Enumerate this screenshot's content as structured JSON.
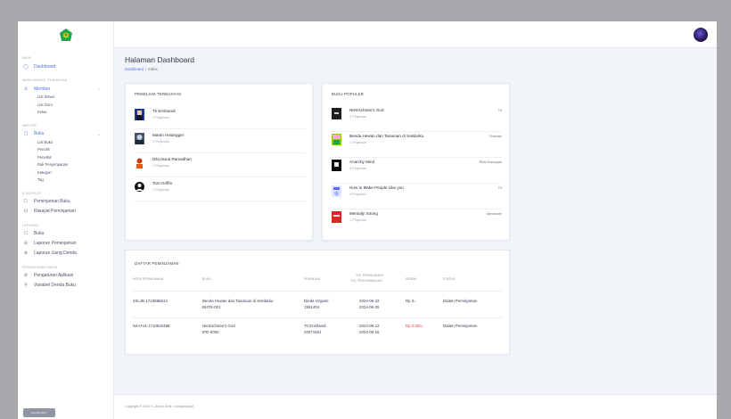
{
  "sidebar": {
    "section_main": "MAIN",
    "dashboard": "Dashboard",
    "section_user": "MANAGEMENT PENGGUNA",
    "member": "Member",
    "member_items": [
      "List Siswa",
      "List Guru",
      "Kelas"
    ],
    "section_master": "MASTER",
    "buku": "Buku",
    "buku_items": [
      "List Buku",
      "Penulis",
      "Penerbit",
      "Rak Penyimpanan",
      "Kategori",
      "Tag"
    ],
    "section_eservice": "E-SERVICE",
    "peminjaman": "Peminjaman Buku",
    "riwayat": "Riwayat Peminjaman",
    "section_laporan": "LAPORAN",
    "lap_buku": "Buku",
    "lap_peminjaman": "Laporan Peminjaman",
    "lap_denda": "Laporan Uang Denda",
    "section_pengaturan": "PENGATURAN UMUM",
    "pengaturan_aplikasi": "Pengaturan Aplikasi",
    "variabel_denda": "Variabel Denda Buku",
    "bottom_button": "SHARE EDIT"
  },
  "header": {
    "title": "Halaman Dashboard",
    "breadcrumb_link": "Dashboard",
    "breadcrumb_sep": "/",
    "breadcrumb_current": "Index"
  },
  "peminjam": {
    "title": "PEMINJAM TERBANYAK",
    "items": [
      {
        "name": "Tri Enshandi",
        "count": "2 Pinjaman"
      },
      {
        "name": "Martin Heidegger",
        "count": "1 Pinjaman"
      },
      {
        "name": "Dila Nurul Ramadhan",
        "count": "1 Pinjaman"
      },
      {
        "name": "Tom Griffin",
        "count": "1 Pinjaman"
      }
    ]
  },
  "populer": {
    "title": "BUKU POPULER",
    "items": [
      {
        "name": "Nietzschean's God",
        "count": "1 Pinjaman",
        "author": "Tri"
      },
      {
        "name": "Benda Hewan dan Tanaman di Sekitarku",
        "count": "1 Pinjaman",
        "author": "Sueldan"
      },
      {
        "name": "Anarchy Mind",
        "count": "4 Pinjaman",
        "author": "Rikki Kamuyah"
      },
      {
        "name": "How to Make People Like you",
        "count": "2 Pinjaman",
        "author": "Tri"
      },
      {
        "name": "Mentally Strong",
        "count": "1 Pinjaman",
        "author": "Alexander"
      }
    ]
  },
  "pinjaman": {
    "title": "DAFTAR PEMINJAMAN",
    "headers": [
      "KODE PEMINJAMAN",
      "BUKU",
      "PEMINJAM",
      "TGL PEMINJAMAN",
      "TGL PENGEMBALIAN",
      "DENDA",
      "STATUS"
    ],
    "rows": [
      {
        "kode": "4SLJB-1710896613",
        "buku": "Benda Hewan dan Tanaman di Sekitarku",
        "buku_kode": "BHTS-001",
        "peminjam": "Dinda Virganti",
        "pem_id": "1551404",
        "tgl_pinjam": "2024-06-22",
        "tgl_kembali": "2024-06-25",
        "denda": "Rp 0,-",
        "status": "Dalam Peminjaman"
      },
      {
        "name": "row2",
        "kode": "N4-HV4-1710832488",
        "buku": "Nietzschean's God",
        "buku_kode": "IPD-0005",
        "peminjam": "Tri Enshandi",
        "pem_id": "20071601",
        "tgl_pinjam": "2024-06-12",
        "tgl_kembali": "2024-06-15",
        "denda": "Rp 2.000,-",
        "status": "Dalam Peminjaman"
      }
    ]
  },
  "footer": {
    "text": "Copyright © 2024 E-Library SDN 1 Mangkurayat"
  },
  "colors": {
    "accent": "#4e73df",
    "logo_green": "#1fa64a",
    "logo_gold": "#f2c21b",
    "denda_red": "#e53e3e"
  }
}
